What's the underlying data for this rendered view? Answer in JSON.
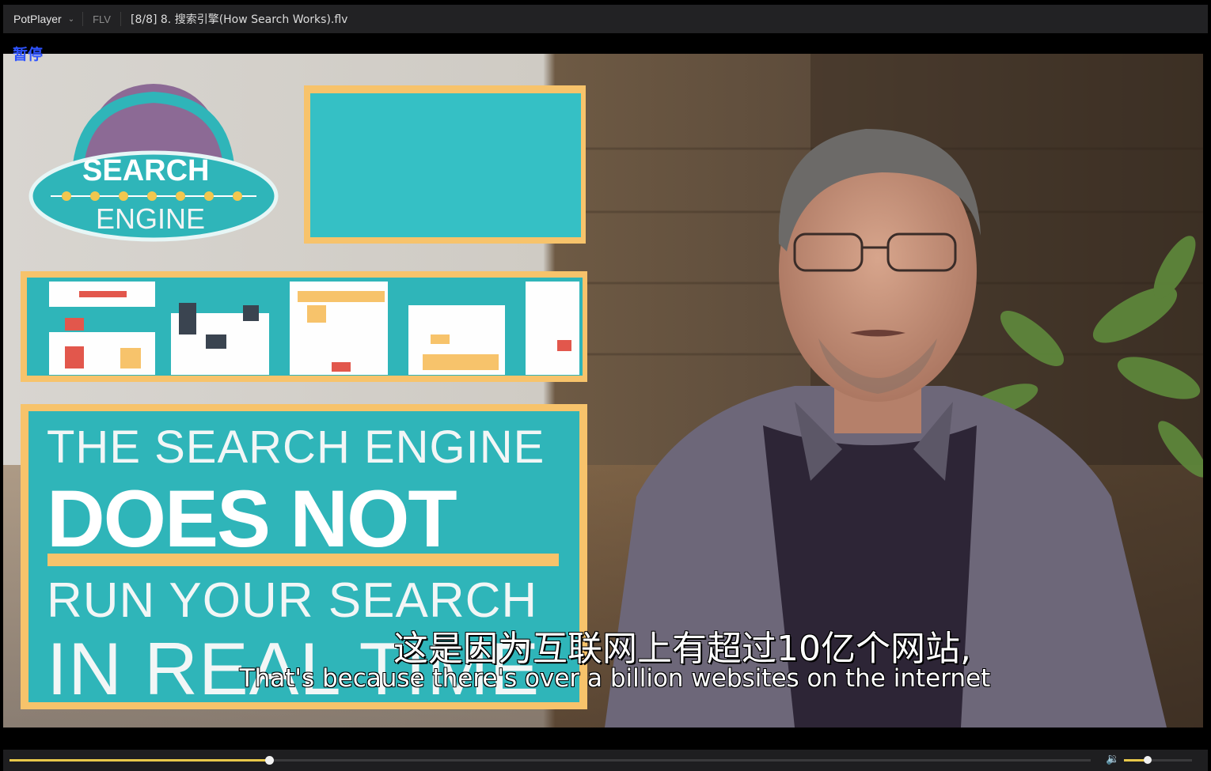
{
  "titlebar": {
    "app_name": "PotPlayer",
    "format": "FLV",
    "file_title": "[8/8] 8. 搜索引擎(How Search Works).flv"
  },
  "osd": {
    "status": "暂停"
  },
  "video": {
    "logo_line1": "SEARCH",
    "logo_line2": "ENGINE",
    "slide_line1": "THE SEARCH ENGINE",
    "slide_line2": "DOES NOT",
    "slide_line3": "RUN YOUR SEARCH",
    "slide_line4": "IN REAL TIME",
    "subtitle_zh": "这是因为互联网上有超过10亿个网站,",
    "subtitle_en": "That's because there's over a billion websites on the internet"
  },
  "controls": {
    "seek_progress": 0.24,
    "volume_level": 0.35
  },
  "colors": {
    "accent": "#e8c84a",
    "osd": "#2d52ff",
    "teal": "#2fb5b9"
  },
  "icons": [
    "chevron-down-icon",
    "volume-icon"
  ]
}
